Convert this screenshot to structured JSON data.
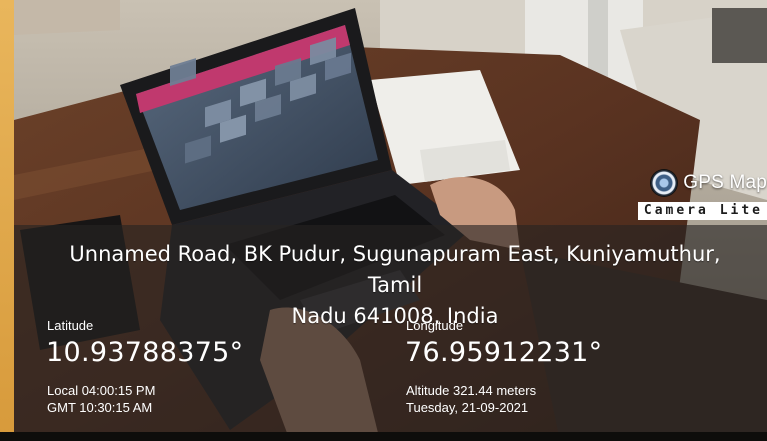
{
  "brand": {
    "name": "GPS Map",
    "tagline": "Camera Lite",
    "icon": "camera-lens-icon"
  },
  "location": {
    "address_line1": "Unnamed Road, BK Pudur, Sugunapuram East, Kuniyamuthur, Tamil",
    "address_line2": "Nadu 641008, India",
    "latitude_label": "Latitude",
    "latitude_value": "10.93788375°",
    "longitude_label": "Longitude",
    "longitude_value": "76.95912231°",
    "local_time": "Local 04:00:15 PM",
    "gmt_time": "GMT 10:30:15 AM",
    "altitude": "Altitude 321.44 meters",
    "date": "Tuesday, 21-09-2021"
  },
  "colors": {
    "overlay": "#262422",
    "text": "#ffffff",
    "laptop_screen_accent": "#c0396e",
    "edge_strip": "#e0a84a"
  }
}
